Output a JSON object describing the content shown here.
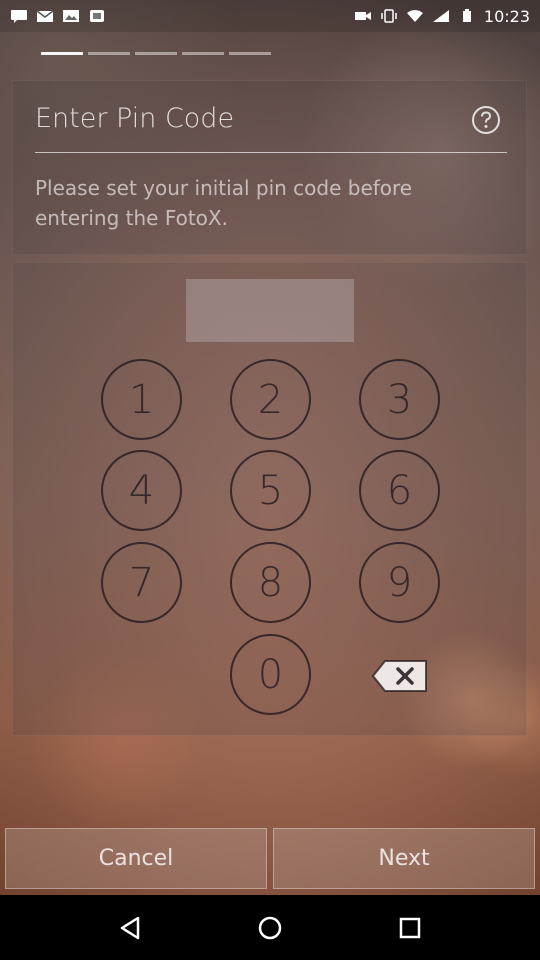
{
  "status_bar": {
    "time": "10:23",
    "icons": [
      "message-icon",
      "mail-icon",
      "image-icon",
      "notification-icon",
      "video-icon",
      "vibrate-icon",
      "wifi-icon",
      "signal-icon",
      "battery-icon"
    ]
  },
  "progress": {
    "total_segments": 5,
    "active_segment": 1
  },
  "pin_entry": {
    "title": "Enter Pin Code",
    "description": "Please set your initial pin code before entering the FotoX.",
    "help_icon": "question-circle-icon"
  },
  "keypad": {
    "keys": [
      {
        "digit": "1"
      },
      {
        "digit": "2"
      },
      {
        "digit": "3"
      },
      {
        "digit": "4"
      },
      {
        "digit": "5"
      },
      {
        "digit": "6"
      },
      {
        "digit": "7"
      },
      {
        "digit": "8"
      },
      {
        "digit": "9"
      },
      {
        "digit": "0"
      }
    ],
    "backspace_icon": "backspace-icon"
  },
  "actions": {
    "cancel_label": "Cancel",
    "next_label": "Next"
  },
  "nav": {
    "icons": [
      "back-icon",
      "home-icon",
      "recents-icon"
    ]
  },
  "colors": {
    "accent_text": "#ffffff",
    "key_outline": "#1e1419"
  }
}
